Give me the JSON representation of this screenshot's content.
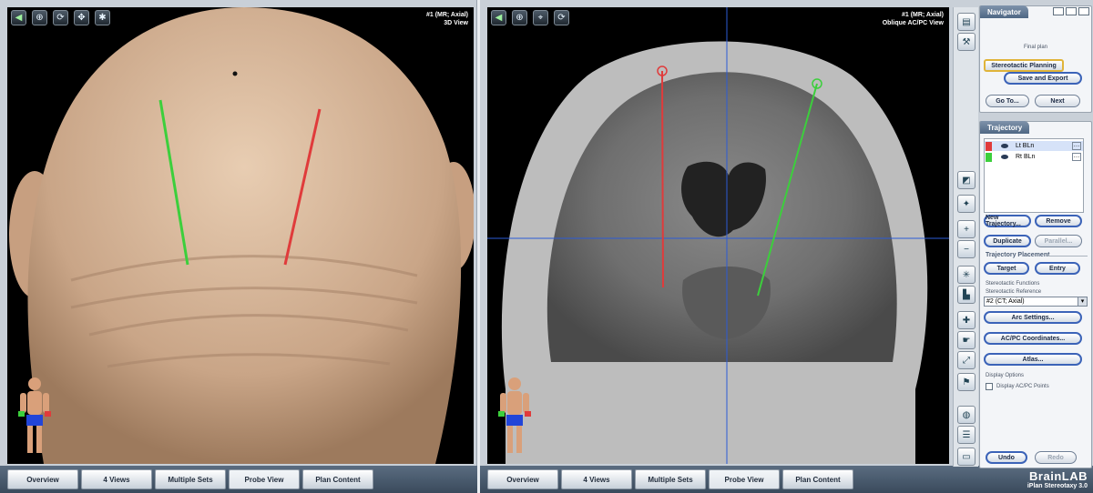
{
  "left_view": {
    "info_line1": "#1 (MR; Axial)",
    "info_line2": "3D View",
    "toolbar": [
      "back-icon",
      "zoom-icon",
      "rotate-icon",
      "pan-icon",
      "axes-icon"
    ]
  },
  "right_view": {
    "info_line1": "#1 (MR; Axial)",
    "info_line2": "Oblique AC/PC View",
    "toolbar": [
      "back-icon",
      "zoom-icon",
      "crosshair-icon",
      "rotate-icon"
    ]
  },
  "tabs_left": [
    "Overview",
    "4 Views",
    "Multiple Sets",
    "Probe View",
    "Plan Content"
  ],
  "tabs_right": [
    "Overview",
    "4 Views",
    "Multiple Sets",
    "Probe View",
    "Plan Content"
  ],
  "navigator": {
    "title": "Navigator",
    "final_plan": "Final plan",
    "stereotactic_planning": "Stereotactic Planning",
    "save_export": "Save and Export",
    "goto": "Go To...",
    "next": "Next"
  },
  "trajectory": {
    "title": "Trajectory",
    "items": [
      {
        "label": "Lt BLn",
        "color": "#e03b3b"
      },
      {
        "label": "Rt BLn",
        "color": "#3ccf3c"
      }
    ],
    "new_trajectory": "New Trajectory...",
    "remove": "Remove",
    "duplicate": "Duplicate",
    "parallel": "Parallel...",
    "placement_title": "Trajectory Placement",
    "target": "Target",
    "entry": "Entry",
    "stereotactic_functions": "Stereotactic Functions",
    "stereotactic_reference": "Stereotactic Reference",
    "reference_value": "#2 (CT; Axial)",
    "arc_settings": "Arc Settings...",
    "acpc_coordinates": "AC/PC Coordinates...",
    "atlas": "Atlas...",
    "display_options": "Display Options",
    "display_acpc": "Display AC/PC Points",
    "undo": "Undo",
    "redo": "Redo"
  },
  "brand": {
    "name": "BrainLAB",
    "product": "iPlan Stereotaxy 3.0"
  },
  "colors": {
    "trajectory_red": "#e03b3b",
    "trajectory_green": "#3ccf3c",
    "crosshair": "#2c5bd6"
  }
}
